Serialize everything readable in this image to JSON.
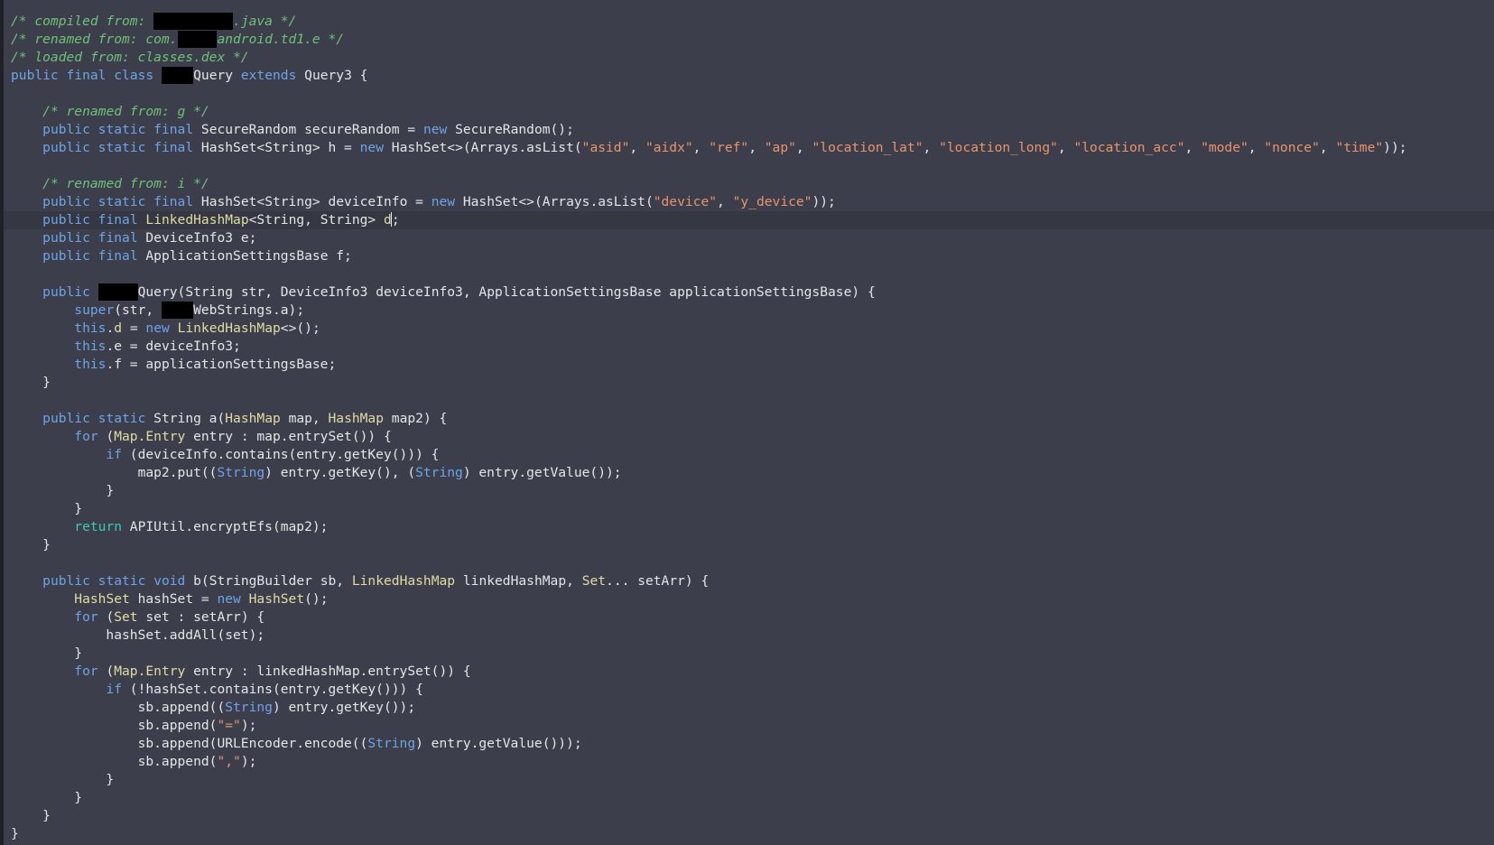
{
  "editor": {
    "language": "Java",
    "theme": {
      "background": "#3c3f4b",
      "current_line": "#353843",
      "keyword": "#6fa3e6",
      "control_keyword": "#3fc7b6",
      "string": "#e8946d",
      "comment": "#6ec07a",
      "type": "#e1dba4",
      "text": "#e4e5e8",
      "redaction": "#000000"
    },
    "current_line_index": 11,
    "lines": [
      [
        [
          "cmt",
          "/* compiled from: "
        ],
        [
          "red",
          "          "
        ],
        [
          "cmt",
          ".java */"
        ]
      ],
      [
        [
          "cmt",
          "/* renamed from: com."
        ],
        [
          "red",
          "     "
        ],
        [
          "cmt",
          "android.td1.e */"
        ]
      ],
      [
        [
          "cmt",
          "/* loaded from: classes.dex */"
        ]
      ],
      [
        [
          "kw",
          "public"
        ],
        [
          "txt",
          " "
        ],
        [
          "kw",
          "final"
        ],
        [
          "txt",
          " "
        ],
        [
          "kw",
          "class"
        ],
        [
          "txt",
          " "
        ],
        [
          "red",
          "    "
        ],
        [
          "txt",
          "Query "
        ],
        [
          "kw",
          "extends"
        ],
        [
          "txt",
          " Query3 {"
        ]
      ],
      [],
      [
        [
          "txt",
          "    "
        ],
        [
          "cmt",
          "/* renamed from: g */"
        ]
      ],
      [
        [
          "txt",
          "    "
        ],
        [
          "kw",
          "public"
        ],
        [
          "txt",
          " "
        ],
        [
          "kw",
          "static"
        ],
        [
          "txt",
          " "
        ],
        [
          "kw",
          "final"
        ],
        [
          "txt",
          " SecureRandom secureRandom = "
        ],
        [
          "kw",
          "new"
        ],
        [
          "txt",
          " SecureRandom();"
        ]
      ],
      [
        [
          "txt",
          "    "
        ],
        [
          "kw",
          "public"
        ],
        [
          "txt",
          " "
        ],
        [
          "kw",
          "static"
        ],
        [
          "txt",
          " "
        ],
        [
          "kw",
          "final"
        ],
        [
          "txt",
          " HashSet<String> h = "
        ],
        [
          "kw",
          "new"
        ],
        [
          "txt",
          " HashSet<>(Arrays.asList("
        ],
        [
          "str",
          "\"asid\""
        ],
        [
          "txt",
          ", "
        ],
        [
          "str",
          "\"aidx\""
        ],
        [
          "txt",
          ", "
        ],
        [
          "str",
          "\"ref\""
        ],
        [
          "txt",
          ", "
        ],
        [
          "str",
          "\"ap\""
        ],
        [
          "txt",
          ", "
        ],
        [
          "str",
          "\"location_lat\""
        ],
        [
          "txt",
          ", "
        ],
        [
          "str",
          "\"location_long\""
        ],
        [
          "txt",
          ", "
        ],
        [
          "str",
          "\"location_acc\""
        ],
        [
          "txt",
          ", "
        ],
        [
          "str",
          "\"mode\""
        ],
        [
          "txt",
          ", "
        ],
        [
          "str",
          "\"nonce\""
        ],
        [
          "txt",
          ", "
        ],
        [
          "str",
          "\"time\""
        ],
        [
          "txt",
          "));"
        ]
      ],
      [],
      [
        [
          "txt",
          "    "
        ],
        [
          "cmt",
          "/* renamed from: i */"
        ]
      ],
      [
        [
          "txt",
          "    "
        ],
        [
          "kw",
          "public"
        ],
        [
          "txt",
          " "
        ],
        [
          "kw",
          "static"
        ],
        [
          "txt",
          " "
        ],
        [
          "kw",
          "final"
        ],
        [
          "txt",
          " HashSet<String> deviceInfo = "
        ],
        [
          "kw",
          "new"
        ],
        [
          "txt",
          " HashSet<>(Arrays.asList("
        ],
        [
          "str",
          "\"device\""
        ],
        [
          "txt",
          ", "
        ],
        [
          "str",
          "\"y_device\""
        ],
        [
          "txt",
          "));"
        ]
      ],
      [
        [
          "txt",
          "    "
        ],
        [
          "kw",
          "public"
        ],
        [
          "txt",
          " "
        ],
        [
          "kw",
          "final"
        ],
        [
          "txt",
          " "
        ],
        [
          "type",
          "LinkedHashMap"
        ],
        [
          "txt",
          "<String, String> "
        ],
        [
          "field",
          "d"
        ],
        [
          "caret",
          ""
        ],
        [
          "txt",
          ";"
        ]
      ],
      [
        [
          "txt",
          "    "
        ],
        [
          "kw",
          "public"
        ],
        [
          "txt",
          " "
        ],
        [
          "kw",
          "final"
        ],
        [
          "txt",
          " DeviceInfo3 e;"
        ]
      ],
      [
        [
          "txt",
          "    "
        ],
        [
          "kw",
          "public"
        ],
        [
          "txt",
          " "
        ],
        [
          "kw",
          "final"
        ],
        [
          "txt",
          " ApplicationSettingsBase f;"
        ]
      ],
      [],
      [
        [
          "txt",
          "    "
        ],
        [
          "kw",
          "public"
        ],
        [
          "txt",
          " "
        ],
        [
          "red",
          "     "
        ],
        [
          "txt",
          "Query(String str, DeviceInfo3 deviceInfo3, ApplicationSettingsBase applicationSettingsBase) {"
        ]
      ],
      [
        [
          "txt",
          "        "
        ],
        [
          "kw",
          "super"
        ],
        [
          "txt",
          "(str, "
        ],
        [
          "red",
          "    "
        ],
        [
          "txt",
          "WebStrings.a);"
        ]
      ],
      [
        [
          "txt",
          "        "
        ],
        [
          "kw",
          "this"
        ],
        [
          "txt",
          "."
        ],
        [
          "field",
          "d"
        ],
        [
          "txt",
          " = "
        ],
        [
          "kw",
          "new"
        ],
        [
          "txt",
          " "
        ],
        [
          "type",
          "LinkedHashMap"
        ],
        [
          "txt",
          "<>();"
        ]
      ],
      [
        [
          "txt",
          "        "
        ],
        [
          "kw",
          "this"
        ],
        [
          "txt",
          ".e = deviceInfo3;"
        ]
      ],
      [
        [
          "txt",
          "        "
        ],
        [
          "kw",
          "this"
        ],
        [
          "txt",
          ".f = applicationSettingsBase;"
        ]
      ],
      [
        [
          "txt",
          "    }"
        ]
      ],
      [],
      [
        [
          "txt",
          "    "
        ],
        [
          "kw",
          "public"
        ],
        [
          "txt",
          " "
        ],
        [
          "kw",
          "static"
        ],
        [
          "txt",
          " String a("
        ],
        [
          "type",
          "HashMap"
        ],
        [
          "txt",
          " map, "
        ],
        [
          "type",
          "HashMap"
        ],
        [
          "txt",
          " map2) {"
        ]
      ],
      [
        [
          "txt",
          "        "
        ],
        [
          "kw",
          "for"
        ],
        [
          "txt",
          " ("
        ],
        [
          "type",
          "Map.Entry"
        ],
        [
          "txt",
          " entry : map.entrySet()) {"
        ]
      ],
      [
        [
          "txt",
          "            "
        ],
        [
          "kw",
          "if"
        ],
        [
          "txt",
          " (deviceInfo.contains(entry.getKey())) {"
        ]
      ],
      [
        [
          "txt",
          "                map2.put(("
        ],
        [
          "kw",
          "String"
        ],
        [
          "txt",
          ") entry.getKey(), ("
        ],
        [
          "kw",
          "String"
        ],
        [
          "txt",
          ") entry.getValue());"
        ]
      ],
      [
        [
          "txt",
          "            }"
        ]
      ],
      [
        [
          "txt",
          "        }"
        ]
      ],
      [
        [
          "txt",
          "        "
        ],
        [
          "kw2",
          "return"
        ],
        [
          "txt",
          " APIUtil.encryptEfs(map2);"
        ]
      ],
      [
        [
          "txt",
          "    }"
        ]
      ],
      [],
      [
        [
          "txt",
          "    "
        ],
        [
          "kw",
          "public"
        ],
        [
          "txt",
          " "
        ],
        [
          "kw",
          "static"
        ],
        [
          "txt",
          " "
        ],
        [
          "kw",
          "void"
        ],
        [
          "txt",
          " b(StringBuilder sb, "
        ],
        [
          "type",
          "LinkedHashMap"
        ],
        [
          "txt",
          " linkedHashMap, "
        ],
        [
          "type",
          "Set"
        ],
        [
          "txt",
          "... setArr) {"
        ]
      ],
      [
        [
          "txt",
          "        "
        ],
        [
          "type",
          "HashSet"
        ],
        [
          "txt",
          " hashSet = "
        ],
        [
          "kw",
          "new"
        ],
        [
          "txt",
          " "
        ],
        [
          "type",
          "HashSet"
        ],
        [
          "txt",
          "();"
        ]
      ],
      [
        [
          "txt",
          "        "
        ],
        [
          "kw",
          "for"
        ],
        [
          "txt",
          " ("
        ],
        [
          "type",
          "Set"
        ],
        [
          "txt",
          " set : setArr) {"
        ]
      ],
      [
        [
          "txt",
          "            hashSet.addAll(set);"
        ]
      ],
      [
        [
          "txt",
          "        }"
        ]
      ],
      [
        [
          "txt",
          "        "
        ],
        [
          "kw",
          "for"
        ],
        [
          "txt",
          " ("
        ],
        [
          "type",
          "Map.Entry"
        ],
        [
          "txt",
          " entry : linkedHashMap.entrySet()) {"
        ]
      ],
      [
        [
          "txt",
          "            "
        ],
        [
          "kw",
          "if"
        ],
        [
          "txt",
          " (!hashSet.contains(entry.getKey())) {"
        ]
      ],
      [
        [
          "txt",
          "                sb.append(("
        ],
        [
          "kw",
          "String"
        ],
        [
          "txt",
          ") entry.getKey());"
        ]
      ],
      [
        [
          "txt",
          "                sb.append("
        ],
        [
          "str",
          "\"=\""
        ],
        [
          "txt",
          ");"
        ]
      ],
      [
        [
          "txt",
          "                sb.append(URLEncoder.encode(("
        ],
        [
          "kw",
          "String"
        ],
        [
          "txt",
          ") entry.getValue()));"
        ]
      ],
      [
        [
          "txt",
          "                sb.append("
        ],
        [
          "str",
          "\",\""
        ],
        [
          "txt",
          ");"
        ]
      ],
      [
        [
          "txt",
          "            }"
        ]
      ],
      [
        [
          "txt",
          "        }"
        ]
      ],
      [
        [
          "txt",
          "    }"
        ]
      ],
      [
        [
          "txt",
          "}"
        ]
      ]
    ]
  }
}
